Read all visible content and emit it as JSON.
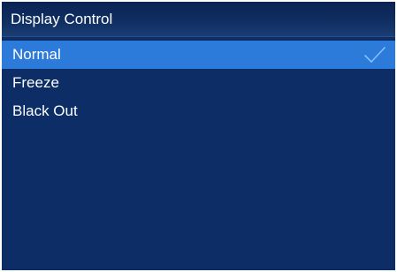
{
  "header": {
    "title": "Display Control"
  },
  "menu": {
    "items": [
      {
        "label": "Normal",
        "selected": true
      },
      {
        "label": "Freeze",
        "selected": false
      },
      {
        "label": "Black Out",
        "selected": false
      }
    ]
  },
  "colors": {
    "background": "#0c2d66",
    "selected": "#2c7ad9",
    "check": "#7fc3ff",
    "text": "#ffffff"
  },
  "icons": {
    "selected_indicator": "checkmark-icon"
  }
}
